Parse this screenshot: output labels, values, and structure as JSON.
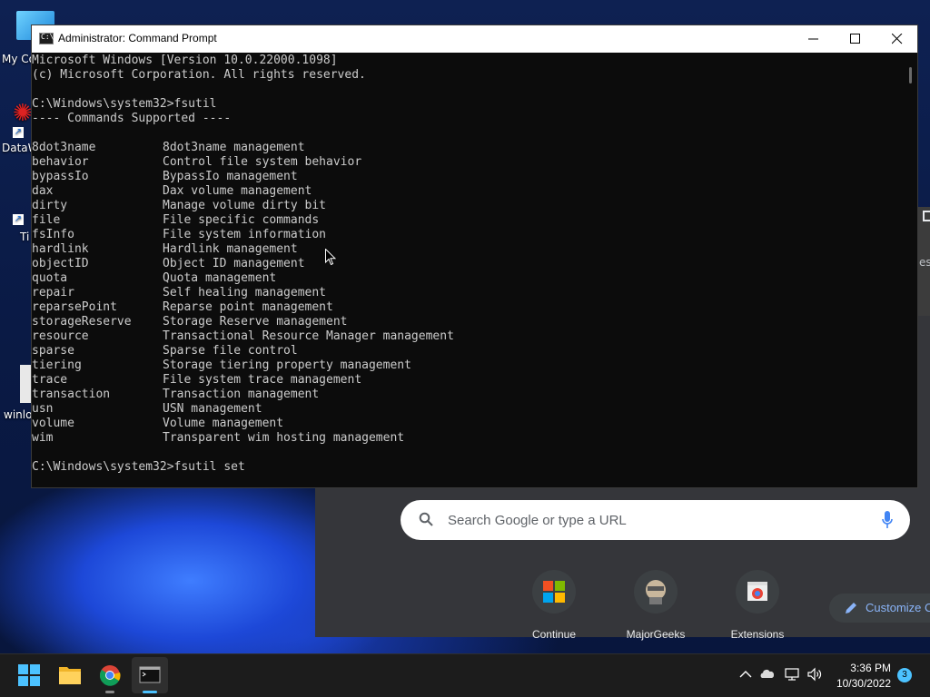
{
  "desktop": {
    "icons": [
      {
        "label": "My Co"
      },
      {
        "label": "DataW"
      },
      {
        "label": "Ti"
      },
      {
        "label": "winlo"
      }
    ]
  },
  "chrome": {
    "search_placeholder": "Search Google or type a URL",
    "shortcuts": [
      {
        "label": "Continue",
        "icon": "microsoft-logo-icon"
      },
      {
        "label": "MajorGeeks",
        "icon": "majorgeeks-icon"
      },
      {
        "label": "Extensions",
        "icon": "chrome-webstore-icon"
      }
    ],
    "customize_label": "Customize C",
    "side_text": "es"
  },
  "cmd": {
    "title": "Administrator: Command Prompt",
    "header_line1": "Microsoft Windows [Version 10.0.22000.1098]",
    "header_line2": "(c) Microsoft Corporation. All rights reserved.",
    "prompt1": "C:\\Windows\\system32>fsutil",
    "commands_header": "---- Commands Supported ----",
    "commands": [
      {
        "name": "8dot3name",
        "desc": "8dot3name management"
      },
      {
        "name": "behavior",
        "desc": "Control file system behavior"
      },
      {
        "name": "bypassIo",
        "desc": "BypassIo management"
      },
      {
        "name": "dax",
        "desc": "Dax volume management"
      },
      {
        "name": "dirty",
        "desc": "Manage volume dirty bit"
      },
      {
        "name": "file",
        "desc": "File specific commands"
      },
      {
        "name": "fsInfo",
        "desc": "File system information"
      },
      {
        "name": "hardlink",
        "desc": "Hardlink management"
      },
      {
        "name": "objectID",
        "desc": "Object ID management"
      },
      {
        "name": "quota",
        "desc": "Quota management"
      },
      {
        "name": "repair",
        "desc": "Self healing management"
      },
      {
        "name": "reparsePoint",
        "desc": "Reparse point management"
      },
      {
        "name": "storageReserve",
        "desc": "Storage Reserve management"
      },
      {
        "name": "resource",
        "desc": "Transactional Resource Manager management"
      },
      {
        "name": "sparse",
        "desc": "Sparse file control"
      },
      {
        "name": "tiering",
        "desc": "Storage tiering property management"
      },
      {
        "name": "trace",
        "desc": "File system trace management"
      },
      {
        "name": "transaction",
        "desc": "Transaction management"
      },
      {
        "name": "usn",
        "desc": "USN management"
      },
      {
        "name": "volume",
        "desc": "Volume management"
      },
      {
        "name": "wim",
        "desc": "Transparent wim hosting management"
      }
    ],
    "prompt2": "C:\\Windows\\system32>fsutil set"
  },
  "taskbar": {
    "time": "3:36 PM",
    "date": "10/30/2022",
    "notification_count": "3"
  },
  "colors": {
    "console_bg": "#0c0c0c",
    "console_text": "#cccccc",
    "taskbar_bg": "#1c1c1c",
    "accent": "#4cc2ff"
  }
}
